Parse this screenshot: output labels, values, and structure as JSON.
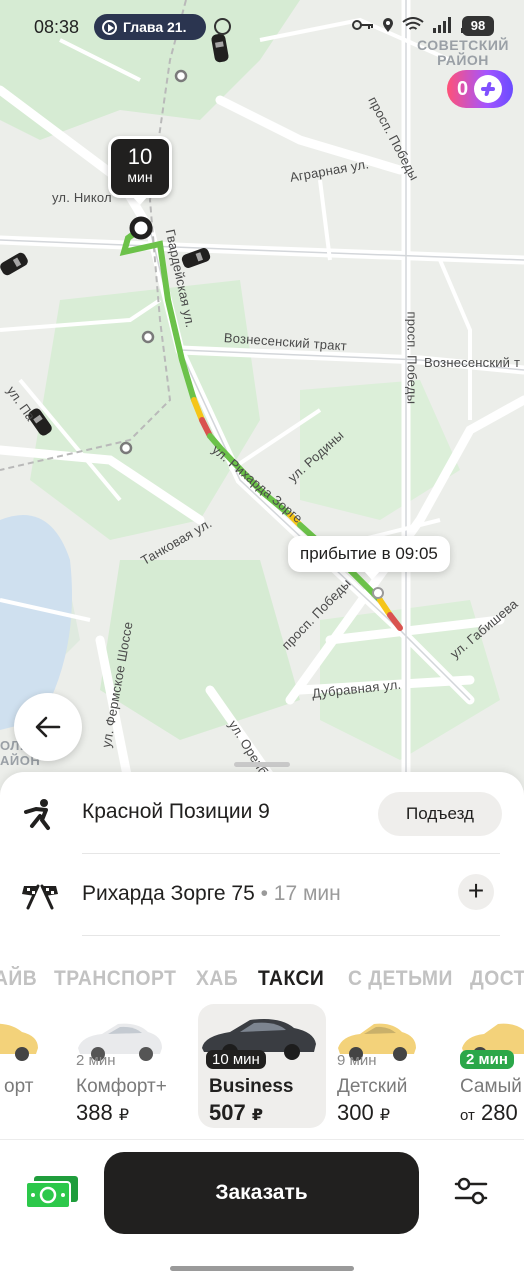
{
  "status_bar": {
    "time": "08:38",
    "nav_pill": "Глава 21.",
    "battery": "98"
  },
  "map": {
    "district_top": "СОВЕТСКИЙ РАЙОН",
    "district_left": "ОЛ. АЙОН",
    "streets": {
      "nikolo": "ул. Никол",
      "gvardeyskaya": "Гвардейская ул.",
      "agrarnaya": "Аграрная ул.",
      "pobedy_top": "просп. Победы",
      "pobedy_mid": "просп. Победы",
      "pobedy_bottom": "просп. Победы",
      "voznesensky_1": "Вознесенский тракт",
      "voznesensky_2": "Вознесенский т",
      "rodiny": "ул. Родины",
      "sorge": "ул. Рихарда Зорге",
      "tankovaya": "Танковая ул.",
      "fermskoe": "ул. Фермское Шоссе",
      "orenburg": "ул. Оренбу",
      "dubravnaya": "Дубравная ул.",
      "gabisheva": "ул. Габишева",
      "papanina": "ул. Па"
    },
    "eta_badge": {
      "value": "10",
      "unit": "мин"
    },
    "arrival_label": "прибытие в 09:05",
    "plus_points": "0"
  },
  "route": {
    "from": "Красной Позиции 9",
    "entrance_button": "Подъезд",
    "to": "Рихарда Зорге 75",
    "to_meta": " • 17 мин",
    "add_stop": "+"
  },
  "tabs": [
    {
      "label": "АЙВ"
    },
    {
      "label": "ТРАНСПОРТ"
    },
    {
      "label": "ХАБ"
    },
    {
      "label": "ТАКСИ",
      "active": true
    },
    {
      "label": "С ДЕТЬМИ"
    },
    {
      "label": "ДОСТ"
    }
  ],
  "tariffs": [
    {
      "name": "орт",
      "eta": "",
      "price": "",
      "currency": ""
    },
    {
      "name": "Комфорт+",
      "eta": "2 мин",
      "price": "388",
      "currency": "₽"
    },
    {
      "name": "Business",
      "eta": "10 мин",
      "price": "507",
      "currency": "₽",
      "selected": true
    },
    {
      "name": "Детский",
      "eta": "9 мин",
      "price": "300",
      "currency": "₽"
    },
    {
      "name": "Самый",
      "eta": "2 мин",
      "price_prefix": "от",
      "price": "280",
      "currency": ""
    }
  ],
  "order_button": "Заказать",
  "colors": {
    "accent_dark": "#21201f",
    "route_green": "#6cc24a",
    "route_yellow": "#f5c518",
    "route_red": "#d9534f",
    "eta_green": "#2ba749",
    "plus_gradient_start": "#ff5277",
    "plus_gradient_end": "#6a4cff"
  },
  "icons": {
    "back": "arrow-left-icon",
    "from": "walking-person-icon",
    "to": "finish-flags-icon",
    "payment": "cash-icon",
    "settings": "sliders-icon"
  }
}
